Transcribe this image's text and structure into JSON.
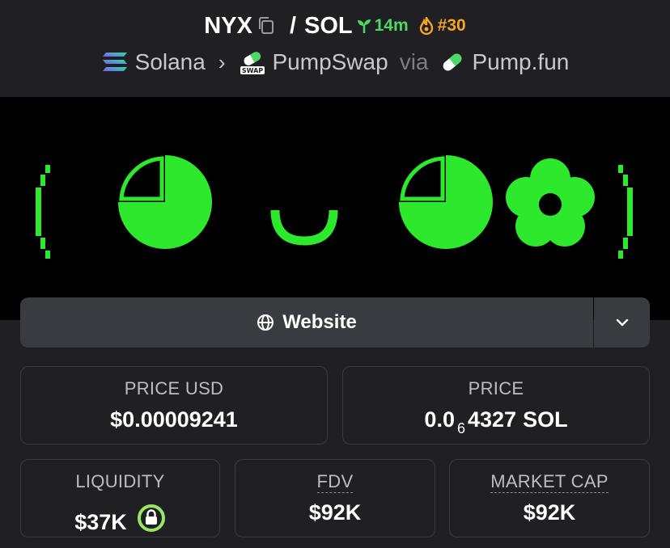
{
  "header": {
    "base_symbol": "NYX",
    "separator": "/",
    "quote_symbol": "SOL",
    "age": "14m",
    "rank": "#30",
    "colors": {
      "age": "#4cd964",
      "rank": "#f5a623"
    }
  },
  "breadcrumb": {
    "chain": "Solana",
    "dex": "PumpSwap",
    "via": "via",
    "launchpad": "Pump.fun",
    "icons": [
      "solana-icon",
      "pumpswap-icon",
      "pump-fun-pill-icon"
    ]
  },
  "banner": {
    "color": "#2ee82e"
  },
  "actions": {
    "website_label": "Website",
    "icons": [
      "globe-icon",
      "chevron-down-icon"
    ]
  },
  "stats": {
    "price_usd": {
      "label": "PRICE USD",
      "value": "$0.00009241"
    },
    "price": {
      "label": "PRICE",
      "prefix": "0.0",
      "zeros": "6",
      "digits": "4327",
      "unit": "SOL"
    },
    "liquidity": {
      "label": "LIQUIDITY",
      "value": "$37K"
    },
    "fdv": {
      "label": "FDV",
      "value": "$92K"
    },
    "market_cap": {
      "label": "MARKET CAP",
      "value": "$92K"
    }
  }
}
